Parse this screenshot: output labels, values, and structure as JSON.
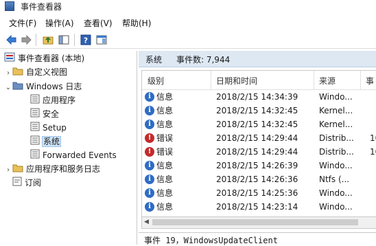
{
  "window": {
    "title": "事件查看器",
    "icon": "event-viewer-icon"
  },
  "menu": [
    "文件(F)",
    "操作(A)",
    "查看(V)",
    "帮助(H)"
  ],
  "toolbar": {
    "icons": [
      "back-arrow-icon",
      "forward-arrow-icon",
      "folder-up-icon",
      "show-hide-tree-icon",
      "help-icon",
      "properties-icon"
    ]
  },
  "tree": {
    "root": "事件查看器 (本地)",
    "custom_views": "自定义视图",
    "windows_logs": "Windows 日志",
    "logs": [
      "应用程序",
      "安全",
      "Setup",
      "系统",
      "Forwarded Events"
    ],
    "selected": "系统",
    "app_service_logs": "应用程序和服务日志",
    "subscriptions": "订阅"
  },
  "panel": {
    "name": "系统",
    "count_label": "事件数: 7,944"
  },
  "grid": {
    "columns": [
      "级别",
      "日期和时间",
      "来源",
      "事"
    ],
    "rows": [
      {
        "level": "信息",
        "type": "info",
        "datetime": "2018/2/15 14:34:39",
        "source": "Windo...",
        "id": ""
      },
      {
        "level": "信息",
        "type": "info",
        "datetime": "2018/2/15 14:32:45",
        "source": "Kernel...",
        "id": ""
      },
      {
        "level": "信息",
        "type": "info",
        "datetime": "2018/2/15 14:32:45",
        "source": "Kernel...",
        "id": ""
      },
      {
        "level": "错误",
        "type": "error",
        "datetime": "2018/2/15 14:29:44",
        "source": "Distrib...",
        "id": "10"
      },
      {
        "level": "错误",
        "type": "error",
        "datetime": "2018/2/15 14:29:44",
        "source": "Distrib...",
        "id": "10"
      },
      {
        "level": "信息",
        "type": "info",
        "datetime": "2018/2/15 14:26:39",
        "source": "Windo...",
        "id": ""
      },
      {
        "level": "信息",
        "type": "info",
        "datetime": "2018/2/15 14:26:36",
        "source": "Ntfs (...",
        "id": ""
      },
      {
        "level": "信息",
        "type": "info",
        "datetime": "2018/2/15 14:25:36",
        "source": "Windo...",
        "id": ""
      },
      {
        "level": "信息",
        "type": "info",
        "datetime": "2018/2/15 14:23:14",
        "source": "Windo...",
        "id": ""
      }
    ]
  },
  "detail": {
    "text": "事件 19，WindowsUpdateClient"
  },
  "colors": {
    "info": "#2f6cc4",
    "error": "#c42b2b",
    "selection": "#cfe3f7",
    "panel_header": "#dde8f3"
  }
}
